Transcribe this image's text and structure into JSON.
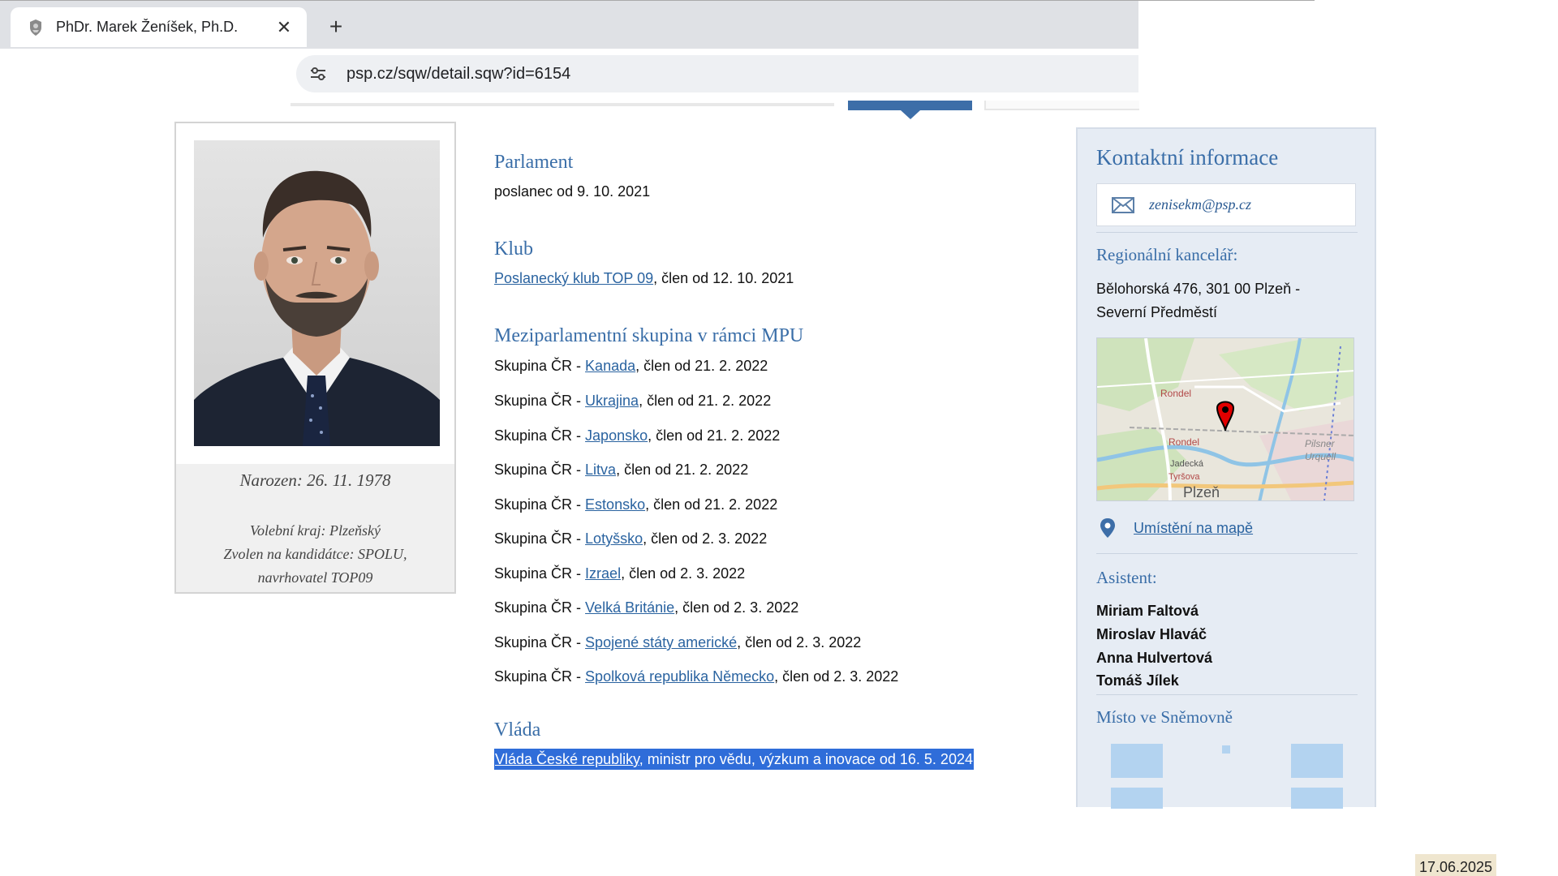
{
  "browser": {
    "tab_title": "PhDr. Marek Ženíšek, Ph.D.",
    "tab_close": "✕",
    "new_tab": "+",
    "url": "psp.cz/sqw/detail.sqw?id=6154"
  },
  "profile": {
    "born": "Narozen: 26. 11. 1978",
    "district_line1": "Volební kraj: Plzeňský",
    "district_line2": "Zvolen na kandidátce: SPOLU,",
    "district_line3": "navrhovatel TOP09"
  },
  "sections": {
    "parlament": {
      "title": "Parlament",
      "text": "poslanec od 9. 10. 2021"
    },
    "klub": {
      "title": "Klub",
      "link": "Poslanecký klub TOP 09",
      "suffix": ", člen od 12. 10. 2021"
    },
    "mpu": {
      "title": "Meziparlamentní skupina v rámci MPU",
      "prefix": "Skupina ČR - ",
      "items": [
        {
          "country": "Kanada",
          "suffix": ", člen od 21. 2. 2022"
        },
        {
          "country": "Ukrajina",
          "suffix": ", člen od 21. 2. 2022"
        },
        {
          "country": "Japonsko",
          "suffix": ", člen od 21. 2. 2022"
        },
        {
          "country": "Litva",
          "suffix": ", člen od 21. 2. 2022"
        },
        {
          "country": "Estonsko",
          "suffix": ", člen od 21. 2. 2022"
        },
        {
          "country": "Lotyšsko",
          "suffix": ", člen od 2. 3. 2022"
        },
        {
          "country": "Izrael",
          "suffix": ", člen od 2. 3. 2022"
        },
        {
          "country": "Velká Británie",
          "suffix": ", člen od 2. 3. 2022"
        },
        {
          "country": "Spojené státy americké",
          "suffix": ", člen od 2. 3. 2022"
        },
        {
          "country": "Spolková republika Německo",
          "suffix": ", člen od 2. 3. 2022"
        }
      ]
    },
    "vlada": {
      "title": "Vláda",
      "link": "Vláda České republiky",
      "suffix": ", ministr pro vědu, výzkum a inovace od 16. 5. 2024"
    }
  },
  "contact": {
    "title": "Kontaktní informace",
    "email": "zenisekm@psp.cz",
    "office_title": "Regionální kancelář:",
    "address_line1": "Bělohorská 476, 301 00  Plzeň -",
    "address_line2": "Severní Předměstí",
    "map_labels": {
      "rondel_top": "Rondel",
      "rondel_mid": "Rondel",
      "radecka": "Jadecká",
      "tyrsova": "Tyršova",
      "plzen": "Plzeň",
      "pilsner": "Pilsner",
      "urquell": "Urquell"
    },
    "map_link": "Umístění na mapě",
    "assistant_title": "Asistent:",
    "assistants": [
      "Miriam Faltová",
      "Miroslav Hlaváč",
      "Anna Hulvertová",
      "Tomáš Jílek"
    ],
    "seat_title": "Místo ve Sněmovně"
  },
  "colors": {
    "heading": "#3a6ea8",
    "link": "#2a63a0",
    "sidebar_bg": "#e6ecf4",
    "selection": "#2f6dd9"
  },
  "date_stamp": "17.06.2025"
}
